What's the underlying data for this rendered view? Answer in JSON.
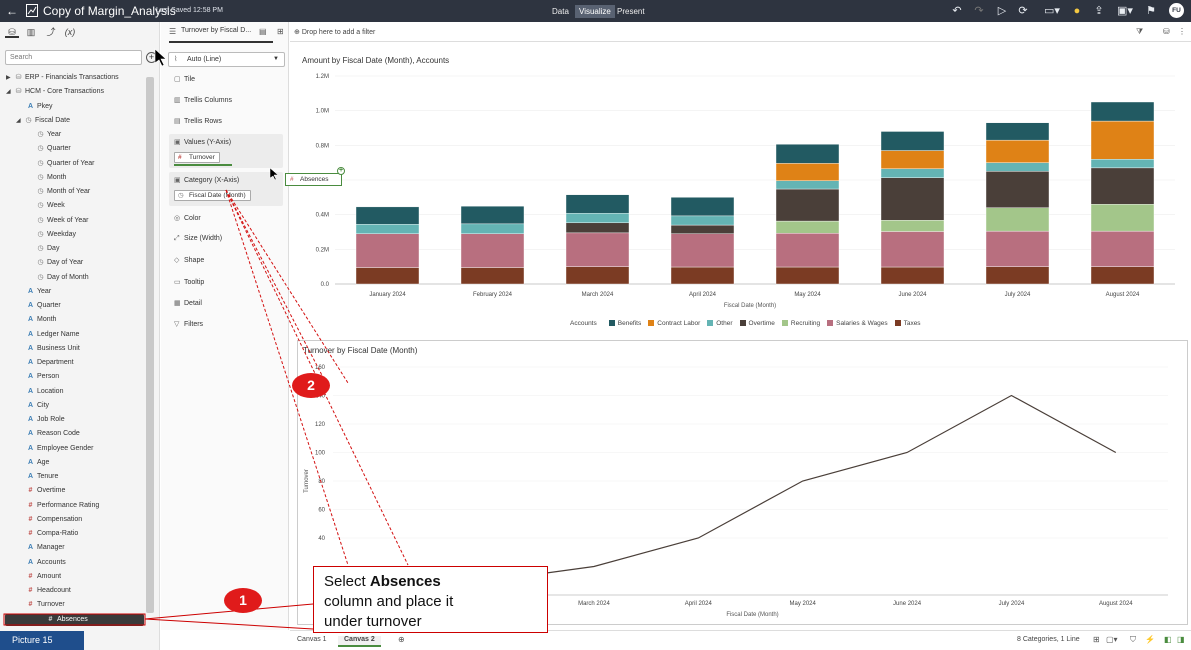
{
  "topbar": {
    "title": "Copy of Margin_Analysis",
    "saved": "Last Saved 12:58 PM",
    "tabs": [
      "Data",
      "Visualize",
      "Present"
    ],
    "active_tab": "Visualize",
    "user_initials": "FU"
  },
  "left_panel": {
    "search_placeholder": "Search",
    "tree": [
      {
        "label": "ERP - Financials Transactions",
        "icon": "db",
        "indent": 0,
        "expanded": false
      },
      {
        "label": "HCM - Core Transactions",
        "icon": "db",
        "indent": 0,
        "expanded": true
      },
      {
        "label": "Pkey",
        "icon": "A",
        "indent": 1
      },
      {
        "label": "Fiscal Date",
        "icon": "clock",
        "indent": 1,
        "expanded": true
      },
      {
        "label": "Year",
        "icon": "clock",
        "indent": 2
      },
      {
        "label": "Quarter",
        "icon": "clock",
        "indent": 2
      },
      {
        "label": "Quarter of Year",
        "icon": "clock",
        "indent": 2
      },
      {
        "label": "Month",
        "icon": "clock",
        "indent": 2
      },
      {
        "label": "Month of Year",
        "icon": "clock",
        "indent": 2
      },
      {
        "label": "Week",
        "icon": "clock",
        "indent": 2
      },
      {
        "label": "Week of Year",
        "icon": "clock",
        "indent": 2
      },
      {
        "label": "Weekday",
        "icon": "clock",
        "indent": 2
      },
      {
        "label": "Day",
        "icon": "clock",
        "indent": 2
      },
      {
        "label": "Day of Year",
        "icon": "clock",
        "indent": 2
      },
      {
        "label": "Day of Month",
        "icon": "clock",
        "indent": 2
      },
      {
        "label": "Year",
        "icon": "A",
        "indent": 1
      },
      {
        "label": "Quarter",
        "icon": "A",
        "indent": 1
      },
      {
        "label": "Month",
        "icon": "A",
        "indent": 1
      },
      {
        "label": "Ledger Name",
        "icon": "A",
        "indent": 1
      },
      {
        "label": "Business Unit",
        "icon": "A",
        "indent": 1
      },
      {
        "label": "Department",
        "icon": "A",
        "indent": 1
      },
      {
        "label": "Person",
        "icon": "A",
        "indent": 1
      },
      {
        "label": "Location",
        "icon": "A",
        "indent": 1
      },
      {
        "label": "City",
        "icon": "A",
        "indent": 1
      },
      {
        "label": "Job Role",
        "icon": "A",
        "indent": 1
      },
      {
        "label": "Reason Code",
        "icon": "A",
        "indent": 1
      },
      {
        "label": "Employee Gender",
        "icon": "A",
        "indent": 1
      },
      {
        "label": "Age",
        "icon": "A",
        "indent": 1
      },
      {
        "label": "Tenure",
        "icon": "A",
        "indent": 1
      },
      {
        "label": "Overtime",
        "icon": "#",
        "indent": 1
      },
      {
        "label": "Performance Rating",
        "icon": "#",
        "indent": 1
      },
      {
        "label": "Compensation",
        "icon": "#",
        "indent": 1
      },
      {
        "label": "Compa-Ratio",
        "icon": "#",
        "indent": 1
      },
      {
        "label": "Manager",
        "icon": "A",
        "indent": 1
      },
      {
        "label": "Accounts",
        "icon": "A",
        "indent": 1
      },
      {
        "label": "Amount",
        "icon": "#",
        "indent": 1
      },
      {
        "label": "Headcount",
        "icon": "#",
        "indent": 1
      },
      {
        "label": "Turnover",
        "icon": "#",
        "indent": 1
      },
      {
        "label": "Absences",
        "icon": "#",
        "indent": 1,
        "selected": true
      }
    ],
    "picture_label": "Picture 15"
  },
  "grammar": {
    "viz_name": "Turnover by Fiscal D...",
    "chart_type": "Auto (Line)",
    "items": [
      "Tile",
      "Trellis Columns",
      "Trellis Rows"
    ],
    "values_label": "Values (Y-Axis)",
    "values_chip": "Turnover",
    "category_label": "Category (X-Axis)",
    "category_chip": "Fiscal Date (Month)",
    "more_items": [
      "Color",
      "Size (Width)",
      "Shape",
      "Tooltip",
      "Detail",
      "Filters"
    ]
  },
  "filterbar": {
    "placeholder": "Drop here to add a filter"
  },
  "drag_chip": "Absences",
  "chart_data": [
    {
      "type": "bar",
      "stacked": true,
      "title": "Amount by Fiscal Date (Month), Accounts",
      "xlabel": "Fiscal Date (Month)",
      "ylabel": "",
      "legend_title": "Accounts",
      "legend_position": "bottom",
      "ylim": [
        0,
        1200000
      ],
      "yticks": [
        "0.0",
        "0.2M",
        "0.4M",
        "0.6M",
        "0.8M",
        "1.0M",
        "1.2M"
      ],
      "categories": [
        "January 2024",
        "February 2024",
        "March 2024",
        "April 2024",
        "May 2024",
        "June 2024",
        "July 2024",
        "August 2024"
      ],
      "series": [
        {
          "name": "Taxes",
          "color": "#7b3b23",
          "values": [
            95000,
            95000,
            100000,
            98000,
            98000,
            98000,
            100000,
            100000
          ]
        },
        {
          "name": "Salaries & Wages",
          "color": "#b86f7f",
          "values": [
            195000,
            195000,
            195000,
            192000,
            195000,
            205000,
            205000,
            205000
          ]
        },
        {
          "name": "Recruiting",
          "color": "#a3c68a",
          "values": [
            0,
            0,
            0,
            0,
            70000,
            65000,
            135000,
            155000
          ]
        },
        {
          "name": "Overtime",
          "color": "#4a3f39",
          "values": [
            0,
            0,
            58000,
            50000,
            185000,
            245000,
            210000,
            210000
          ]
        },
        {
          "name": "Other",
          "color": "#64b4b4",
          "values": [
            55000,
            57000,
            55000,
            53000,
            48000,
            52000,
            50000,
            50000
          ]
        },
        {
          "name": "Contract Labor",
          "color": "#df8216",
          "values": [
            0,
            0,
            0,
            0,
            100000,
            105000,
            130000,
            220000
          ]
        },
        {
          "name": "Benefits",
          "color": "#225a62",
          "values": [
            100000,
            102000,
            107000,
            107000,
            110000,
            110000,
            100000,
            110000
          ]
        }
      ]
    },
    {
      "type": "line",
      "title": "Turnover by Fiscal Date (Month)",
      "xlabel": "Fiscal Date (Month)",
      "ylabel": "Turnover",
      "ylim": [
        0,
        160
      ],
      "yticks": [
        "40",
        "60",
        "80",
        "100",
        "120",
        "140",
        "160"
      ],
      "categories": [
        "March 2024",
        "April 2024",
        "May 2024",
        "June 2024",
        "July 2024",
        "August 2024"
      ],
      "x_all": [
        "January 2024",
        "February 2024",
        "March 2024",
        "April 2024",
        "May 2024",
        "June 2024",
        "July 2024",
        "August 2024"
      ],
      "series": [
        {
          "name": "Turnover",
          "color": "#4a3f39",
          "values": [
            0,
            10,
            20,
            40,
            80,
            100,
            140,
            100
          ]
        }
      ]
    }
  ],
  "callout": {
    "line1_prefix": "Select ",
    "line1_bold": "Absences",
    "line2": "column and place it",
    "line3": "under turnover"
  },
  "badges": [
    "1",
    "2"
  ],
  "bottombar": {
    "tabs": [
      "Canvas 1",
      "Canvas 2"
    ],
    "active_tab": "Canvas 2",
    "status": "8 Categories, 1 Line"
  }
}
